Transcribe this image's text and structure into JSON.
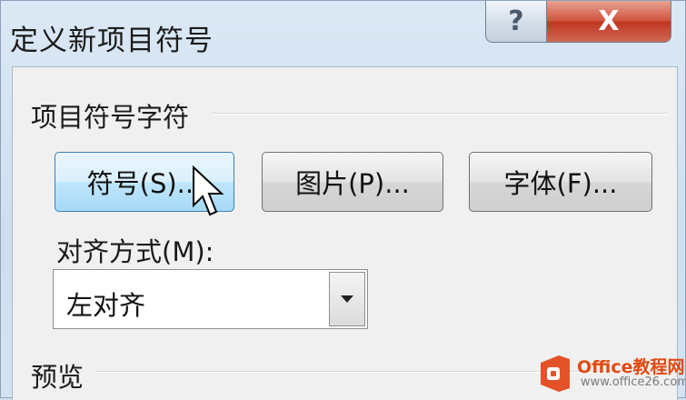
{
  "dialog": {
    "title": "定义新项目符号",
    "help_label": "?",
    "close_label": "X"
  },
  "group_bullet": {
    "label": "项目符号字符",
    "buttons": [
      {
        "label": "符号(S)..."
      },
      {
        "label": "图片(P)..."
      },
      {
        "label": "字体(F)..."
      }
    ]
  },
  "alignment": {
    "label": "对齐方式(M):",
    "value": "左对齐"
  },
  "group_preview": {
    "label": "预览"
  },
  "watermark": {
    "line1": "Office教程网",
    "line2": "www.office26.com"
  }
}
